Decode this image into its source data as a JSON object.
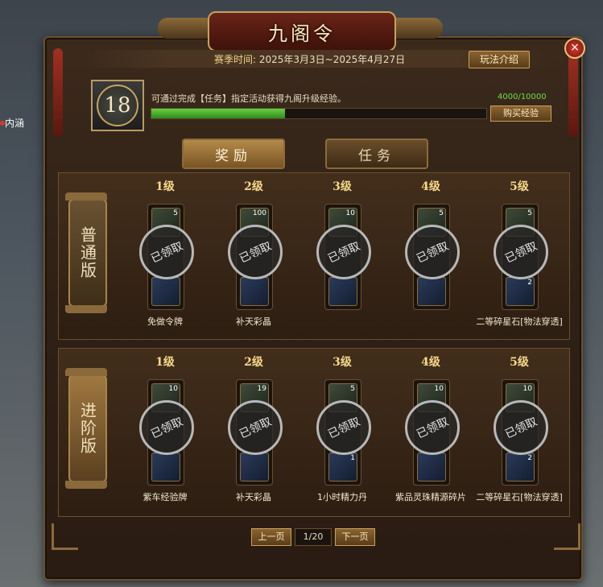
{
  "window": {
    "title": "九阁令"
  },
  "season": {
    "label": "赛季时间:",
    "dates": "2025年3月3日~2025年4月27日"
  },
  "buttons": {
    "rules": "玩法介绍",
    "buy_xp": "购买经验",
    "close": "×"
  },
  "progress": {
    "level": "18",
    "description": "可通过完成【任务】指定活动获得九阁升级经验。",
    "xp_text": "4000/10000",
    "xp_fraction": 0.4
  },
  "tabs": [
    {
      "label": "奖励"
    },
    {
      "label": "任务"
    }
  ],
  "tiers": [
    {
      "label": "普通版",
      "levels": [
        {
          "level": "1级",
          "top_count": "5",
          "bottom_count": "",
          "name": "免做令牌",
          "claimed": "已领取"
        },
        {
          "level": "2级",
          "top_count": "100",
          "bottom_count": "",
          "name": "补天彩晶",
          "claimed": "已领取"
        },
        {
          "level": "3级",
          "top_count": "10",
          "bottom_count": "",
          "name": "",
          "claimed": "已领取"
        },
        {
          "level": "4级",
          "top_count": "5",
          "bottom_count": "",
          "name": "",
          "claimed": "已领取"
        },
        {
          "level": "5级",
          "top_count": "5",
          "bottom_count": "2",
          "name": "二等碎星石[物法穿透]",
          "claimed": "已领取"
        }
      ]
    },
    {
      "label": "进阶版",
      "levels": [
        {
          "level": "1级",
          "top_count": "10",
          "bottom_count": "",
          "name": "紫车经验牌",
          "claimed": "已领取"
        },
        {
          "level": "2级",
          "top_count": "19",
          "bottom_count": "",
          "name": "补天彩晶",
          "claimed": "已领取"
        },
        {
          "level": "3级",
          "top_count": "5",
          "bottom_count": "1",
          "name": "1小时精力丹",
          "claimed": "已领取"
        },
        {
          "level": "4级",
          "top_count": "10",
          "bottom_count": "",
          "name": "紫品灵珠精源碎片",
          "claimed": "已领取"
        },
        {
          "level": "5级",
          "top_count": "10",
          "bottom_count": "2",
          "name": "二等碎星石[物法穿透]",
          "claimed": "已领取"
        }
      ]
    }
  ],
  "pager": {
    "prev": "上一页",
    "page": "1/20",
    "next": "下一页"
  },
  "background": {
    "side_text": "内涵"
  },
  "colors": {
    "accent_gold": "#f5d88a",
    "xp_green": "#6fdc4a",
    "panel_brown": "#2e2016"
  }
}
